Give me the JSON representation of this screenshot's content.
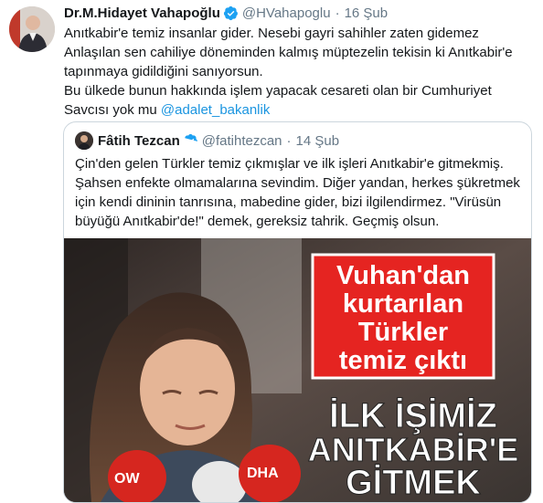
{
  "tweet": {
    "author_name": "Dr.M.Hidayet Vahapoğlu",
    "handle": "@HVahapoglu",
    "separator": "·",
    "date": "16 Şub",
    "lines": [
      "Anıtkabir'e temiz insanlar gider. Nesebi gayri sahihler zaten gidemez",
      "Anlaşılan sen cahiliye döneminden kalmış müptezelin tekisin ki Anıtkabir'e",
      "tapınmaya gidildiğini sanıyorsun.",
      "Bu ülkede bunun hakkında işlem yapacak cesareti olan bir Cumhuriyet"
    ],
    "last_line_prefix": "Savcısı yok mu ",
    "mention": "@adalet_bakanlik"
  },
  "quote": {
    "author_name": "Fâtih Tezcan",
    "handle": "@fatihtezcan",
    "separator": "·",
    "date": "14 Şub",
    "lines": [
      "Çin'den gelen Türkler temiz çıkmışlar ve ilk işleri Anıtkabir'e gitmekmiş.",
      "Şahsen enfekte olmamalarına sevindim. Diğer yandan, herkes şükretmek",
      "için kendi dininin tanrısına, mabedine gider, bizi ilgilendirmez. \"Virüsün",
      "büyüğü Anıtkabir'de!\" demek, gereksiz tahrik. Geçmiş olsun."
    ],
    "media": {
      "banner_lines": [
        "Vuhan'dan",
        "kurtarılan",
        "Türkler",
        "temiz çıktı"
      ],
      "headline_lines": [
        "İLK İŞİMİZ",
        "ANITKABİR'E",
        "GİTMEK"
      ],
      "mic_labels": [
        "OW",
        "DHA"
      ]
    }
  },
  "colors": {
    "verified": "#1da1f2",
    "mention": "#1b95e0",
    "banner_red": "#e52421",
    "meta_gray": "#657786"
  },
  "icons": {
    "verified": "verified-badge-icon"
  }
}
